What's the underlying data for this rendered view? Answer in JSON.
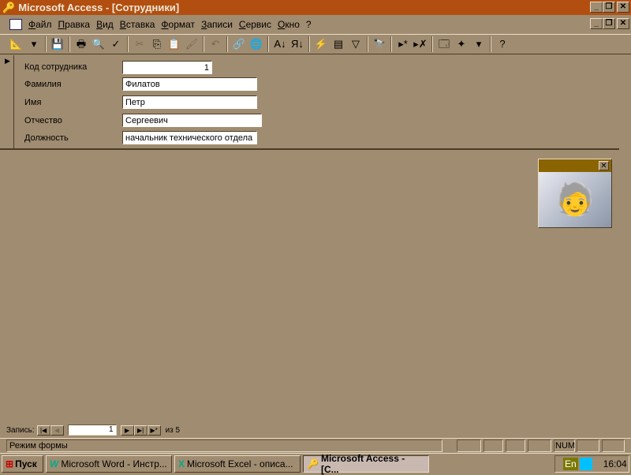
{
  "title": "Microsoft Access - [Сотрудники]",
  "menu": [
    "Файл",
    "Правка",
    "Вид",
    "Вставка",
    "Формат",
    "Записи",
    "Сервис",
    "Окно",
    "?"
  ],
  "toolbar": [
    {
      "icon": "design-view-icon",
      "g": "📐"
    },
    {
      "icon": "dropdown-icon",
      "g": "▾"
    },
    {
      "sep": true
    },
    {
      "icon": "save-icon",
      "g": "💾"
    },
    {
      "sep": true
    },
    {
      "icon": "print-icon",
      "g": "🖶"
    },
    {
      "icon": "print-preview-icon",
      "g": "🔍"
    },
    {
      "icon": "spelling-icon",
      "g": "✓"
    },
    {
      "sep": true
    },
    {
      "icon": "cut-icon",
      "g": "✂",
      "dis": true
    },
    {
      "icon": "copy-icon",
      "g": "⎘"
    },
    {
      "icon": "paste-icon",
      "g": "📋",
      "dis": true
    },
    {
      "icon": "format-painter-icon",
      "g": "🖌",
      "dis": true
    },
    {
      "sep": true
    },
    {
      "icon": "undo-icon",
      "g": "↶",
      "dis": true
    },
    {
      "sep": true
    },
    {
      "icon": "hyperlink-icon",
      "g": "🔗",
      "dis": true
    },
    {
      "icon": "web-toolbar-icon",
      "g": "🌐"
    },
    {
      "sep": true
    },
    {
      "icon": "sort-ascending-icon",
      "g": "А↓"
    },
    {
      "icon": "sort-descending-icon",
      "g": "Я↓"
    },
    {
      "sep": true
    },
    {
      "icon": "filter-by-selection-icon",
      "g": "⚡"
    },
    {
      "icon": "filter-by-form-icon",
      "g": "▤"
    },
    {
      "icon": "apply-filter-icon",
      "g": "▽"
    },
    {
      "sep": true
    },
    {
      "icon": "find-icon",
      "g": "🔭"
    },
    {
      "sep": true
    },
    {
      "icon": "new-record-icon",
      "g": "▸*"
    },
    {
      "icon": "delete-record-icon",
      "g": "▸✗"
    },
    {
      "sep": true
    },
    {
      "icon": "database-window-icon",
      "g": "🗔"
    },
    {
      "icon": "new-object-icon",
      "g": "✦"
    },
    {
      "icon": "dropdown-icon",
      "g": "▾"
    },
    {
      "sep": true
    },
    {
      "icon": "help-icon",
      "g": "?"
    }
  ],
  "fields": [
    {
      "label": "Код сотрудника",
      "value": "1"
    },
    {
      "label": "Фамилия",
      "value": "Филатов"
    },
    {
      "label": "Имя",
      "value": "Петр"
    },
    {
      "label": "Отчество",
      "value": "Сергеевич"
    },
    {
      "label": "Должность",
      "value": "начальник технического отдела"
    }
  ],
  "nav": {
    "label": "Запись:",
    "current": "1",
    "of": "из 5"
  },
  "status": {
    "text": "Режим формы",
    "num": "NUM"
  },
  "taskbar": {
    "start": "Пуск",
    "tasks": [
      "Microsoft Word - Инстр...",
      "Microsoft Excel - описа...",
      "Microsoft Access - [С..."
    ],
    "lang": "En",
    "clock": "16:04"
  }
}
